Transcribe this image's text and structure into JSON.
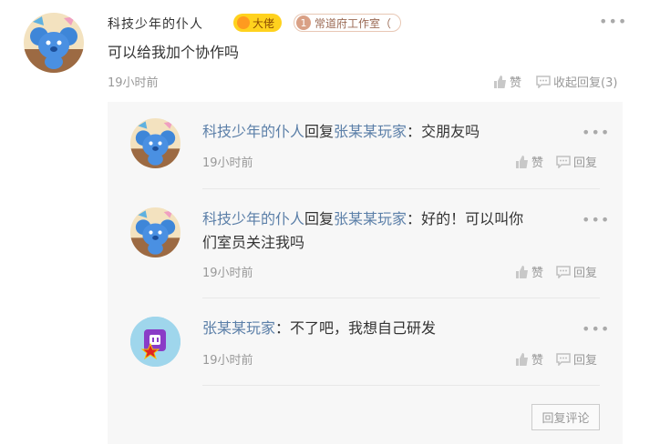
{
  "main_comment": {
    "username": "科技少年的仆人",
    "level_badge": "大佬",
    "fans_badge_num": "1",
    "fans_badge_text": "常道府工作室（",
    "text": "可以给我加个协作吗",
    "time": "19小时前",
    "like_label": "赞",
    "collapse_label": "收起回复(3)",
    "more_icon": "more-dots-icon"
  },
  "replies": [
    {
      "author": "科技少年的仆人",
      "reply_word": "回复",
      "target": "张某某玩家",
      "colon": "：",
      "text": "交朋友吗",
      "time": "19小时前",
      "like_label": "赞",
      "reply_label": "回复"
    },
    {
      "author": "科技少年的仆人",
      "reply_word": "回复",
      "target": "张某某玩家",
      "colon": "：",
      "text_line1": "好的！可以叫你",
      "text_line2": "们室员关注我吗",
      "time": "19小时前",
      "like_label": "赞",
      "reply_label": "回复"
    },
    {
      "author": "张某某玩家",
      "colon": "：",
      "text": "不了吧，我想自己研发",
      "time": "19小时前",
      "like_label": "赞",
      "reply_label": "回复"
    }
  ],
  "reply_button": "回复评论",
  "colors": {
    "name_link": "#5b7fa8",
    "reply_bg": "#f7f7f7",
    "muted": "#999999"
  }
}
